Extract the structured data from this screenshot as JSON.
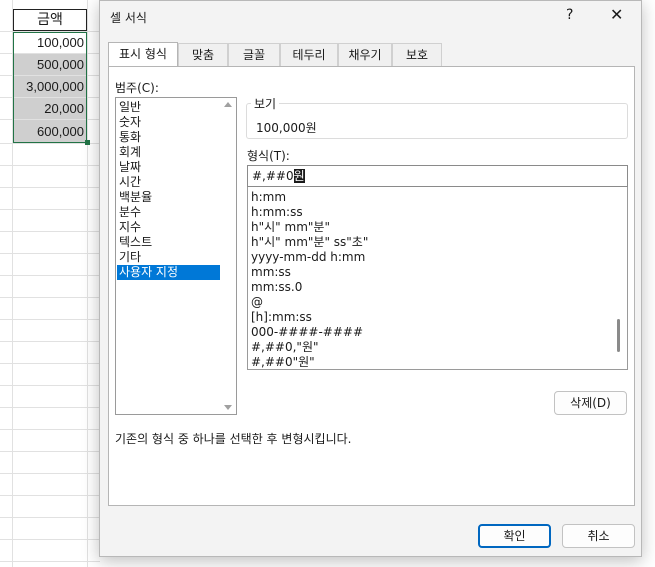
{
  "sheet": {
    "header": "금액",
    "values": [
      "100,000",
      "500,000",
      "3,000,000",
      "20,000",
      "600,000"
    ]
  },
  "dialog": {
    "title": "셀 서식",
    "help_label": "?",
    "close_label": "✕",
    "tabs": [
      "표시 형식",
      "맞춤",
      "글꼴",
      "테두리",
      "채우기",
      "보호"
    ],
    "category_label": "범주(C):",
    "categories": [
      "일반",
      "숫자",
      "통화",
      "회계",
      "날짜",
      "시간",
      "백분율",
      "분수",
      "지수",
      "텍스트",
      "기타",
      "사용자 지정"
    ],
    "selected_category": "사용자 지정",
    "sample_label": "보기",
    "sample_value": "100,000원",
    "type_label": "형식(T):",
    "type_value_prefix": "#,##0",
    "type_value_selected": "원",
    "format_list": [
      "h:mm",
      "h:mm:ss",
      "h\"시\" mm\"분\"",
      "h\"시\" mm\"분\" ss\"초\"",
      "yyyy-mm-dd h:mm",
      "mm:ss",
      "mm:ss.0",
      "@",
      "[h]:mm:ss",
      "000-####-####",
      "#,##0,\"원\"",
      "#,##0\"원\""
    ],
    "delete_button": "삭제(D)",
    "description": "기존의 형식 중 하나를 선택한 후 변형시킵니다.",
    "ok_button": "확인",
    "cancel_button": "취소"
  }
}
